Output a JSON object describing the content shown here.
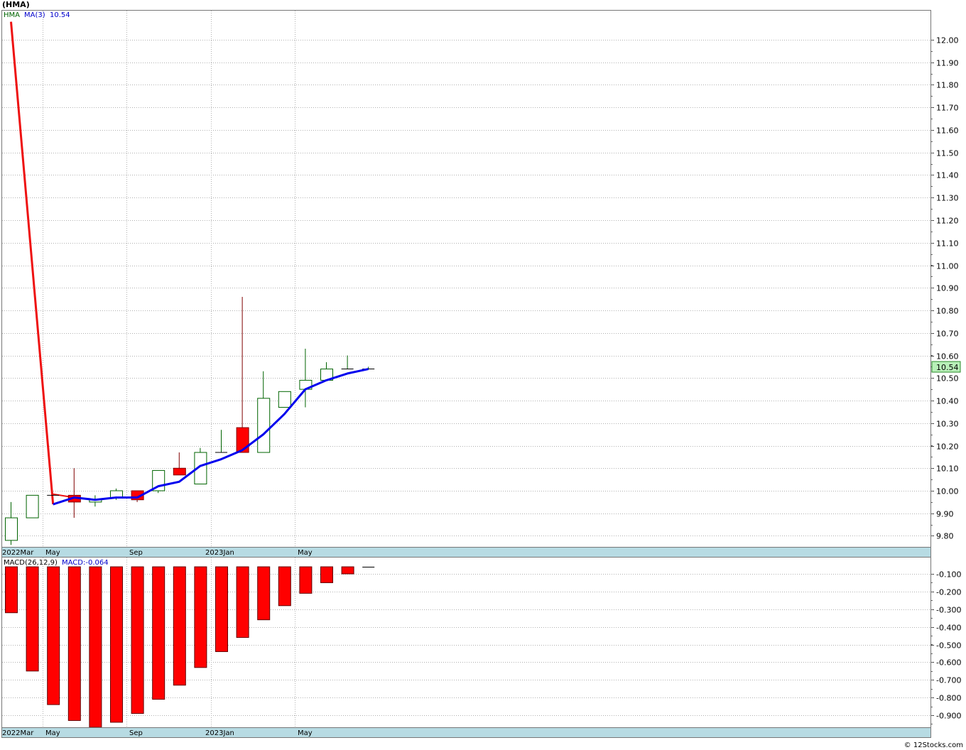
{
  "header": {
    "title": "(HMA)"
  },
  "price_panel": {
    "legend_symbol": "HMA",
    "legend_ma": "MA(3)",
    "legend_ma_value": "10.54",
    "last_price_label": "10.54",
    "colors": {
      "up": "#006400",
      "down": "#ff0000",
      "ma": "#0000ee",
      "drop": "#ee1111",
      "last_label_bg": "#b8f0b8"
    }
  },
  "macd_panel": {
    "legend_name": "MACD(26,12,9)",
    "legend_value": "MACD:-0.064",
    "colors": {
      "bar": "#ff0000"
    }
  },
  "x_axis": {
    "labels": [
      "2022Mar",
      "May",
      "Sep",
      "2023Jan",
      "May"
    ],
    "axis_bg": "#b7dbe3"
  },
  "footer": {
    "copyright": "© 12Stocks.com"
  },
  "chart_data": [
    {
      "type": "candlestick",
      "title": "(HMA)",
      "x": [
        "2022-03",
        "2022-04",
        "2022-05",
        "2022-06",
        "2022-07",
        "2022-08",
        "2022-09",
        "2022-10",
        "2022-11",
        "2022-12",
        "2023-01",
        "2023-02",
        "2023-03",
        "2023-04",
        "2023-05",
        "2023-06",
        "2023-07",
        "2023-08"
      ],
      "x_tick_labels": [
        "2022Mar",
        "May",
        "Sep",
        "2023Jan",
        "May"
      ],
      "candles": [
        {
          "o": 9.78,
          "h": 9.95,
          "l": 9.76,
          "c": 9.88
        },
        {
          "o": 9.88,
          "h": 9.98,
          "l": 9.88,
          "c": 9.98
        },
        {
          "o": 9.98,
          "h": 9.98,
          "l": 9.98,
          "c": 9.98
        },
        {
          "o": 9.98,
          "h": 10.1,
          "l": 9.88,
          "c": 9.95
        },
        {
          "o": 9.95,
          "h": 9.98,
          "l": 9.93,
          "c": 9.96
        },
        {
          "o": 9.97,
          "h": 10.01,
          "l": 9.96,
          "c": 10.0
        },
        {
          "o": 10.0,
          "h": 10.0,
          "l": 9.95,
          "c": 9.96
        },
        {
          "o": 10.0,
          "h": 10.09,
          "l": 9.99,
          "c": 10.09
        },
        {
          "o": 10.1,
          "h": 10.17,
          "l": 10.07,
          "c": 10.07
        },
        {
          "o": 10.03,
          "h": 10.19,
          "l": 10.03,
          "c": 10.17
        },
        {
          "o": 10.17,
          "h": 10.27,
          "l": 10.17,
          "c": 10.17
        },
        {
          "o": 10.28,
          "h": 10.86,
          "l": 10.17,
          "c": 10.17
        },
        {
          "o": 10.17,
          "h": 10.53,
          "l": 10.17,
          "c": 10.41
        },
        {
          "o": 10.37,
          "h": 10.44,
          "l": 10.37,
          "c": 10.44
        },
        {
          "o": 10.45,
          "h": 10.63,
          "l": 10.37,
          "c": 10.49
        },
        {
          "o": 10.49,
          "h": 10.57,
          "l": 10.49,
          "c": 10.54
        },
        {
          "o": 10.54,
          "h": 10.6,
          "l": 10.54,
          "c": 10.54
        },
        {
          "o": 10.54,
          "h": 10.55,
          "l": 10.54,
          "c": 10.54
        }
      ],
      "ma3": [
        12.08,
        null,
        9.94,
        9.97,
        9.96,
        9.97,
        9.97,
        10.02,
        10.04,
        10.11,
        10.14,
        10.18,
        10.25,
        10.34,
        10.45,
        10.49,
        10.52,
        10.54
      ],
      "ylim": [
        9.77,
        12.13
      ],
      "yticks": [
        9.8,
        9.9,
        10.0,
        10.1,
        10.2,
        10.3,
        10.4,
        10.5,
        10.6,
        10.7,
        10.8,
        10.9,
        11.0,
        11.1,
        11.2,
        11.3,
        11.4,
        11.5,
        11.6,
        11.7,
        11.8,
        11.9,
        12.0
      ],
      "ytick_labels": [
        "9.80",
        "9.90",
        "10.00",
        "10.10",
        "10.20",
        "10.30",
        "10.40",
        "10.50",
        "10.60",
        "10.70",
        "10.80",
        "10.90",
        "11.00",
        "11.10",
        "11.20",
        "11.30",
        "11.40",
        "11.50",
        "11.60",
        "11.70",
        "11.80",
        "11.90",
        "12.00"
      ],
      "last_value": 10.54,
      "grid": true
    },
    {
      "type": "bar",
      "title": "MACD(26,12,9)",
      "x": [
        "2022-03",
        "2022-04",
        "2022-05",
        "2022-06",
        "2022-07",
        "2022-08",
        "2022-09",
        "2022-10",
        "2022-11",
        "2022-12",
        "2023-01",
        "2023-02",
        "2023-03",
        "2023-04",
        "2023-05",
        "2023-06",
        "2023-07",
        "2023-08"
      ],
      "values": [
        -0.32,
        -0.65,
        -0.84,
        -0.93,
        -0.97,
        -0.94,
        -0.89,
        -0.81,
        -0.73,
        -0.63,
        -0.54,
        -0.46,
        -0.36,
        -0.28,
        -0.21,
        -0.15,
        -0.1,
        -0.064
      ],
      "ylim": [
        -0.97,
        -0.04
      ],
      "yticks": [
        -0.1,
        -0.2,
        -0.3,
        -0.4,
        -0.5,
        -0.6,
        -0.7,
        -0.8,
        -0.9
      ],
      "ytick_labels": [
        "-0.100",
        "-0.200",
        "-0.300",
        "-0.400",
        "-0.500",
        "-0.600",
        "-0.700",
        "-0.800",
        "-0.900"
      ],
      "baseline": -0.06,
      "grid": true
    }
  ]
}
